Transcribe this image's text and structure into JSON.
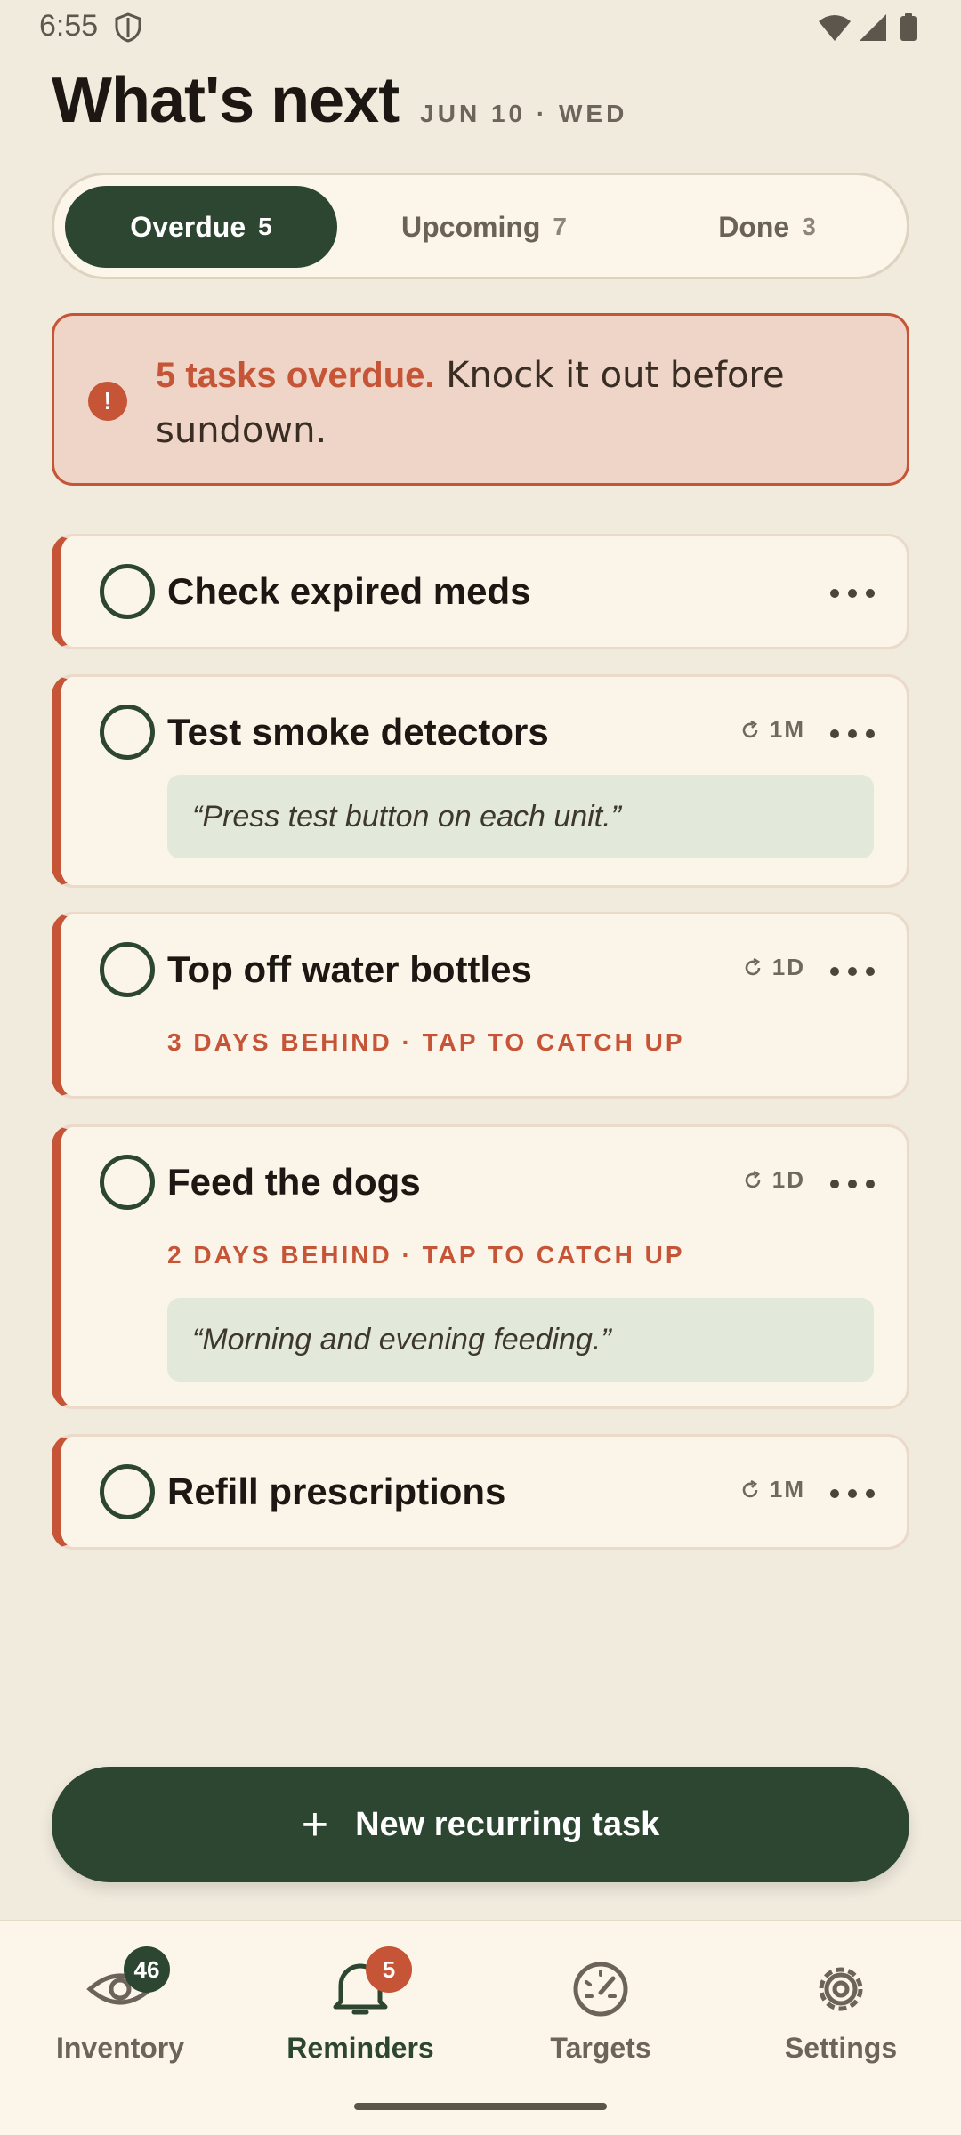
{
  "status_bar": {
    "time": "6:55"
  },
  "header": {
    "title": "What's next",
    "date": "JUN 10 · WED"
  },
  "tabs": [
    {
      "label": "Overdue",
      "count": "5",
      "active": true
    },
    {
      "label": "Upcoming",
      "count": "7",
      "active": false
    },
    {
      "label": "Done",
      "count": "3",
      "active": false
    }
  ],
  "alert": {
    "icon": "!",
    "strong": "5 tasks overdue.",
    "text": " Knock it out before sundown."
  },
  "tasks": [
    {
      "title": "Check expired meds"
    },
    {
      "title": "Test smoke detectors",
      "repeat": "1M",
      "note": "“Press test button on each unit.”"
    },
    {
      "title": "Top off water bottles",
      "repeat": "1D",
      "behind": "3 DAYS BEHIND · TAP TO CATCH UP"
    },
    {
      "title": "Feed the dogs",
      "repeat": "1D",
      "behind": "2 DAYS BEHIND · TAP TO CATCH UP",
      "note": "“Morning and evening feeding.”"
    },
    {
      "title": "Refill prescriptions",
      "repeat": "1M"
    }
  ],
  "fab": {
    "plus": "+",
    "label": "New recurring task"
  },
  "nav": [
    {
      "label": "Inventory",
      "badge": "46",
      "icon": "eye-icon"
    },
    {
      "label": "Reminders",
      "badge": "5",
      "icon": "bell-icon",
      "active": true
    },
    {
      "label": "Targets",
      "icon": "gauge-icon"
    },
    {
      "label": "Settings",
      "icon": "gear-icon"
    }
  ],
  "colors": {
    "accent": "#2c4632",
    "danger": "#c65436",
    "background": "#f1ebdd",
    "card": "#fbf4e9",
    "note": "#e2e9da"
  }
}
